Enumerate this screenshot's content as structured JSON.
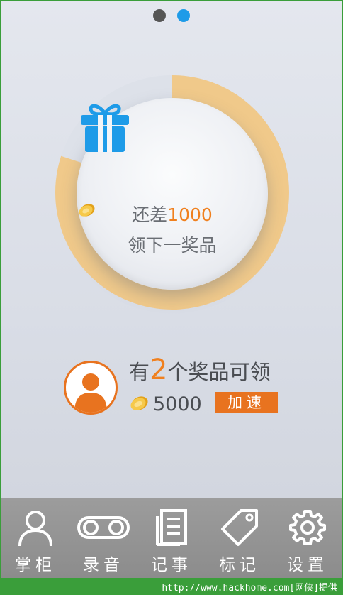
{
  "pager": {
    "count": 2,
    "active_index": 1
  },
  "progress": {
    "fraction_completed": 0.8,
    "colors": {
      "fill": "#f0c98a",
      "track": "#dde1e9"
    }
  },
  "reward": {
    "line1_prefix": "还差",
    "remaining": "1000",
    "line2": "领下一奖品",
    "gift_icon": "gift-icon"
  },
  "prizes": {
    "prefix": "有",
    "count": "2",
    "suffix": "个奖品可领",
    "coins": "5000",
    "speed_label": "加速"
  },
  "tabs": [
    {
      "label": "掌柜",
      "icon": "person-icon"
    },
    {
      "label": "录音",
      "icon": "voicemail-icon"
    },
    {
      "label": "记事",
      "icon": "notebook-icon"
    },
    {
      "label": "标记",
      "icon": "tag-icon"
    },
    {
      "label": "设置",
      "icon": "gear-icon"
    }
  ],
  "watermark": "http://www.hackhome.com[网侠]提供",
  "colors": {
    "accent": "#f0801e",
    "blue": "#1e9be8",
    "tabbar": "#949494"
  }
}
